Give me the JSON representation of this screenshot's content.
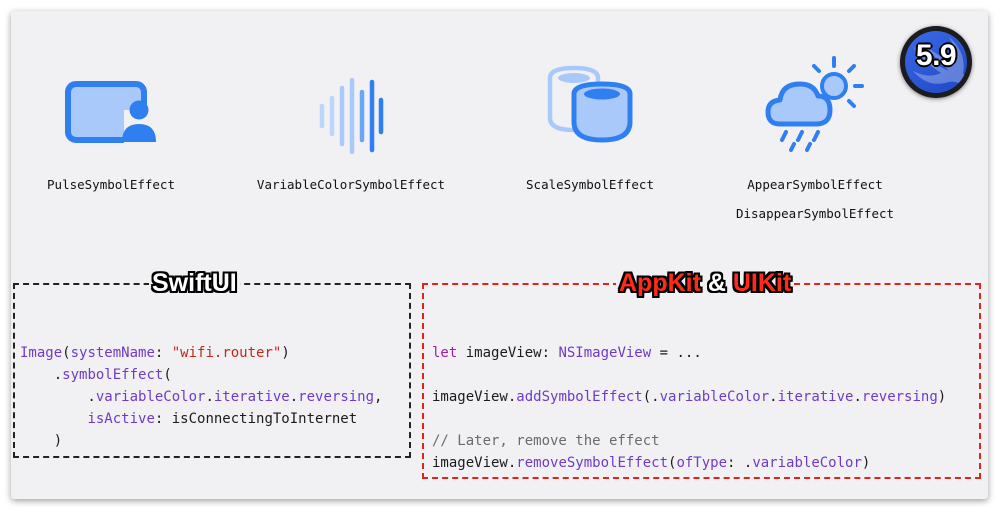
{
  "badge": {
    "text": "5.9"
  },
  "effects": [
    {
      "label": "PulseSymbolEffect"
    },
    {
      "label": "VariableColorSymbolEffect"
    },
    {
      "label": "ScaleSymbolEffect"
    },
    {
      "label": "AppearSymbolEffect",
      "label2": "DisappearSymbolEffect"
    }
  ],
  "swiftui": {
    "title": "SwiftUI",
    "code": {
      "l1_type": "Image",
      "l1_paren": "(",
      "l1_param": "systemName",
      "l1_colon": ": ",
      "l1_string": "\"wifi.router\"",
      "l1_close": ")",
      "l2_dot": "    .",
      "l2_fn": "symbolEffect",
      "l2_paren": "(",
      "l3_indent": "        .",
      "l3_a": "variableColor",
      "l3_dot1": ".",
      "l3_b": "iterative",
      "l3_dot2": ".",
      "l3_c": "reversing",
      "l3_comma": ",",
      "l4_indent": "        ",
      "l4_param": "isActive",
      "l4_rest": ": isConnectingToInternet",
      "l5": "    )"
    }
  },
  "appkit": {
    "title_a": "AppKit",
    "title_amp": " & ",
    "title_b": "UIKit",
    "code": {
      "l1_kw": "let",
      "l1_mid": " imageView: ",
      "l1_type": "NSImageView",
      "l1_rest": " = ...",
      "l2_obj": "imageView.",
      "l2_fn": "addSymbolEffect",
      "l2_paren": "(.",
      "l2_a": "variableColor",
      "l2_dot1": ".",
      "l2_b": "iterative",
      "l2_dot2": ".",
      "l2_c": "reversing",
      "l2_close": ")",
      "l3_comment": "// Later, remove the effect",
      "l4_obj": "imageView.",
      "l4_fn": "removeSymbolEffect",
      "l4_paren": "(",
      "l4_param": "ofType",
      "l4_colon": ": .",
      "l4_val": "variableColor",
      "l4_close": ")"
    }
  },
  "colors": {
    "symbol_blue": "#2f7ff0",
    "symbol_light": "#a9c9fb",
    "keyword": "#a21da6",
    "function": "#6f3bc6",
    "string": "#c4261d",
    "red_border": "#e2231a"
  },
  "icons": [
    "person-screen-icon",
    "waveform-icon",
    "cylinder-scale-icon",
    "cloud-sun-rain-icon"
  ]
}
